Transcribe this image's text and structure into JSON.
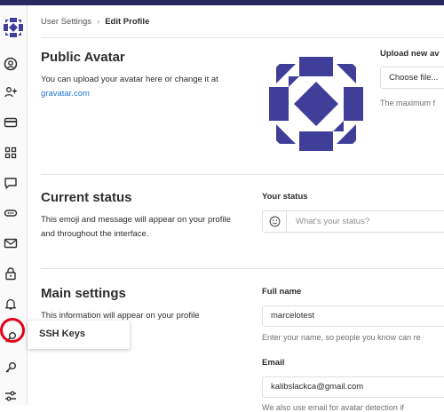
{
  "breadcrumb": {
    "parent": "User Settings",
    "separator": "›",
    "current": "Edit Profile"
  },
  "avatar_section": {
    "title": "Public Avatar",
    "desc_prefix": "You can upload your avatar here or change it at",
    "gravatar_link": "gravatar.com",
    "upload_label": "Upload new av",
    "choose_file": "Choose file...",
    "max_text": "The maximum f"
  },
  "status_section": {
    "title": "Current status",
    "desc": "This emoji and message will appear on your profile and throughout the interface.",
    "label": "Your status",
    "placeholder": "What's your status?"
  },
  "main_section": {
    "title": "Main settings",
    "desc": "This information will appear on your profile",
    "full_name_label": "Full name",
    "full_name_value": "marcelotest",
    "full_name_help": "Enter your name, so people you know can re",
    "email_label": "Email",
    "email_value": "kalibslackca@gmail.com",
    "email_help": "We also use email for avatar detection if"
  },
  "tooltip": {
    "label": "SSH Keys"
  },
  "sidebar": {
    "items": [
      {
        "name": "profile-icon"
      },
      {
        "name": "account-icon"
      },
      {
        "name": "billing-icon"
      },
      {
        "name": "applications-icon"
      },
      {
        "name": "chat-icon"
      },
      {
        "name": "access-tokens-icon"
      },
      {
        "name": "emails-icon"
      },
      {
        "name": "password-icon"
      },
      {
        "name": "notifications-icon"
      },
      {
        "name": "ssh-keys-icon"
      },
      {
        "name": "gpg-keys-icon"
      },
      {
        "name": "preferences-icon"
      }
    ]
  },
  "colors": {
    "topbar": "#292961",
    "avatar": "#3f3f9a",
    "link": "#1f78d1",
    "highlight": "#e3001b"
  }
}
